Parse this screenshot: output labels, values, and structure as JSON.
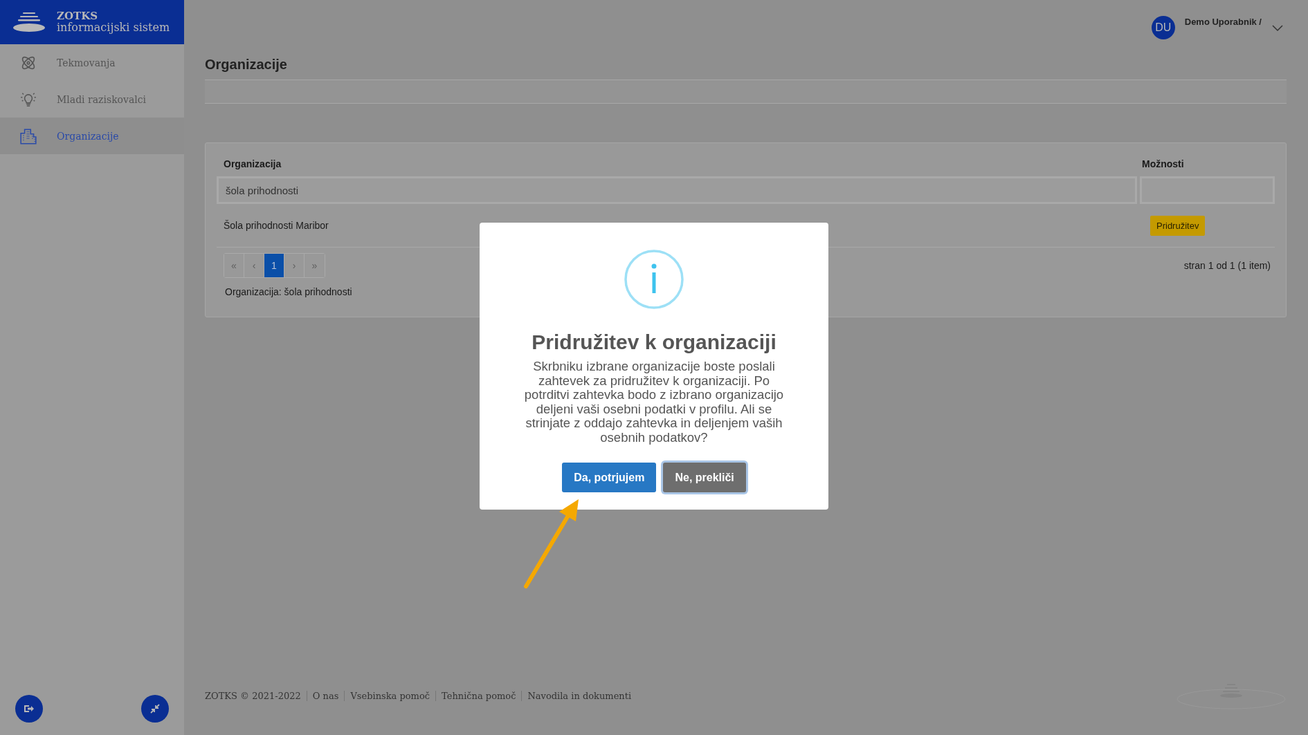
{
  "sidebar": {
    "brand": {
      "title": "ZOTKS",
      "subtitle": "informacijski sistem"
    },
    "items": [
      {
        "label": "Tekmovanja",
        "selected": false
      },
      {
        "label": "Mladi raziskovalci",
        "selected": false
      },
      {
        "label": "Organizacije",
        "selected": true
      }
    ]
  },
  "user": {
    "initials": "DU",
    "name": "Demo Uporabnik /"
  },
  "page_title": "Organizacije",
  "table": {
    "columns": [
      "Organizacija",
      "Možnosti"
    ],
    "filter": {
      "value": "šola prihodnosti"
    },
    "rows": [
      {
        "name": "Šola prihodnosti Maribor",
        "action": "Pridružitev"
      }
    ],
    "pager": [
      {
        "label": "«",
        "selected": false,
        "disabled": true
      },
      {
        "label": "‹",
        "selected": false,
        "disabled": true
      },
      {
        "label": "1",
        "selected": true,
        "disabled": false
      },
      {
        "label": "›",
        "selected": false,
        "disabled": true
      },
      {
        "label": "»",
        "selected": false,
        "disabled": true
      }
    ],
    "summary": "stran 1 od 1 (1 item)",
    "filter_note": "Organizacija: šola prihodnosti"
  },
  "dialog": {
    "title": "Pridružitev k organizaciji",
    "message": "Skrbniku izbrane organizacije boste poslali zahtevek za pridružitev k organizaciji. Po potrditvi zahtevka bodo z izbrano organizacijo deljeni vaši osebni podatki v profilu. Ali se strinjate z oddajo zahtevka in deljenjem vaših osebnih podatkov?",
    "buttons": [
      {
        "label": "Da, potrjujem",
        "kind": "primary"
      },
      {
        "label": "Ne, prekliči",
        "kind": "secondary"
      }
    ]
  },
  "footer": {
    "copyright": "ZOTKS © 2021-2022",
    "links": [
      "O nas",
      "Vsebinska pomoč",
      "Tehnična pomoč",
      "Navodila in dokumenti"
    ]
  }
}
